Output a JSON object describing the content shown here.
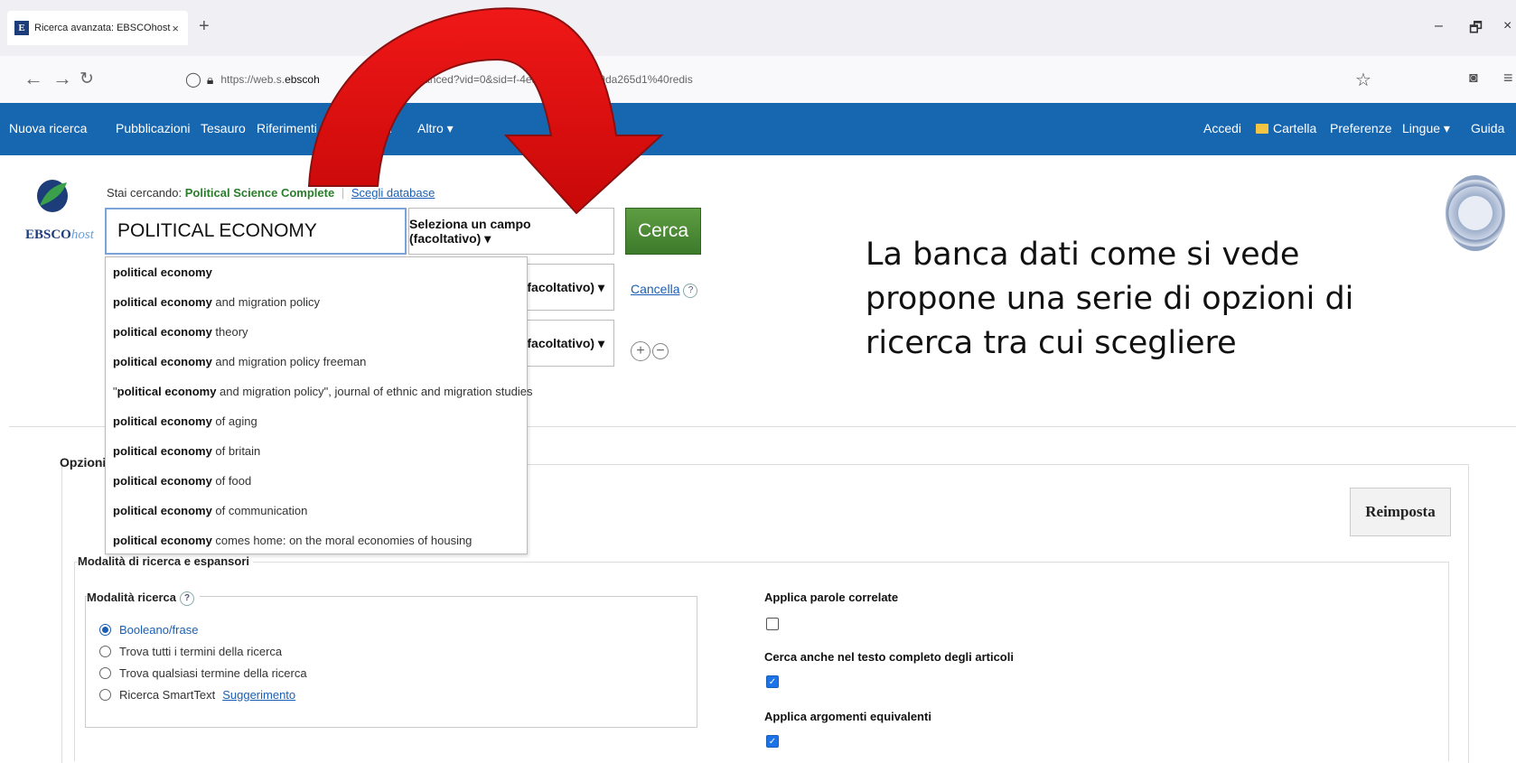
{
  "browser": {
    "tab_title": "Ricerca avanzata: EBSCOhost",
    "tab_close": "×",
    "new_tab": "+",
    "win_minimize": "–",
    "win_maximize": "🗗",
    "win_close": "×",
    "url_prefix": "https://web.s.",
    "url_host": "ebscoh",
    "url_mid": "                 search/advanced?vid=0&sid=",
    "url_end": "f-4ea5-8bd0-3e949da265d1%40redis"
  },
  "toolbar": {
    "left_items": [
      "Nuova ricerca",
      "Pubblicazioni",
      "Tesauro",
      "Riferimenti",
      "gini",
      "Altro ▾"
    ],
    "right_items": [
      "Accedi",
      "Cartella",
      "Preferenze",
      "Lingue ▾",
      "Guida"
    ]
  },
  "search": {
    "logo": "EBSCO",
    "logo_suffix": "host",
    "searching_label": "Stai cercando:",
    "database": "Political Science Complete",
    "choose_db": "Scegli database",
    "query": "POLITICAL ECONOMY",
    "field_select_1": "Seleziona un campo (facoltativo) ▾",
    "field_select_2": "(facoltativo) ▾",
    "field_select_3": "(facoltativo) ▾",
    "search_button": "Cerca",
    "clear_link": "Cancella",
    "help": "?",
    "add_row": "+",
    "remove_row": "−"
  },
  "suggestions": [
    {
      "bold": "political economy",
      "rest": ""
    },
    {
      "bold": "political economy",
      "rest": " and migration policy"
    },
    {
      "bold": "political economy",
      "rest": " theory"
    },
    {
      "bold": "political economy",
      "rest": " and migration policy freeman"
    },
    {
      "bold": "political economy",
      "rest": " and migration policy\", journal of ethnic and migration studies",
      "prefix": "\""
    },
    {
      "bold": "political economy",
      "rest": " of aging"
    },
    {
      "bold": "political economy",
      "rest": " of britain"
    },
    {
      "bold": "political economy",
      "rest": " of food"
    },
    {
      "bold": "political economy",
      "rest": " of communication"
    },
    {
      "bold": "political economy",
      "rest": " comes home: on the moral economies of housing"
    }
  ],
  "annotation": "La banca dati come si vede propone una serie di opzioni di ricerca tra cui scegliere",
  "options": {
    "section_label": "Opzioni",
    "reset_button": "Reimposta",
    "modes_legend": "Modalità di ricerca e espansori",
    "search_mode_legend": "Modalità ricerca",
    "modes": [
      {
        "label": "Booleano/frase",
        "selected": true
      },
      {
        "label": "Trova tutti i termini della ricerca",
        "selected": false
      },
      {
        "label": "Trova qualsiasi termine della ricerca",
        "selected": false
      },
      {
        "label": "Ricerca SmartText",
        "selected": false
      }
    ],
    "smarttext_link": "Suggerimento",
    "expanders": [
      {
        "label": "Applica parole correlate",
        "checked": false
      },
      {
        "label": "Cerca anche nel testo completo degli articoli",
        "checked": true
      },
      {
        "label": "Applica argomenti equivalenti",
        "checked": true
      }
    ]
  },
  "colors": {
    "toolbar_bg": "#1666b0",
    "search_button": "#4a8a34",
    "arrow_red": "#e01010",
    "link_blue": "#1a5fb4"
  }
}
